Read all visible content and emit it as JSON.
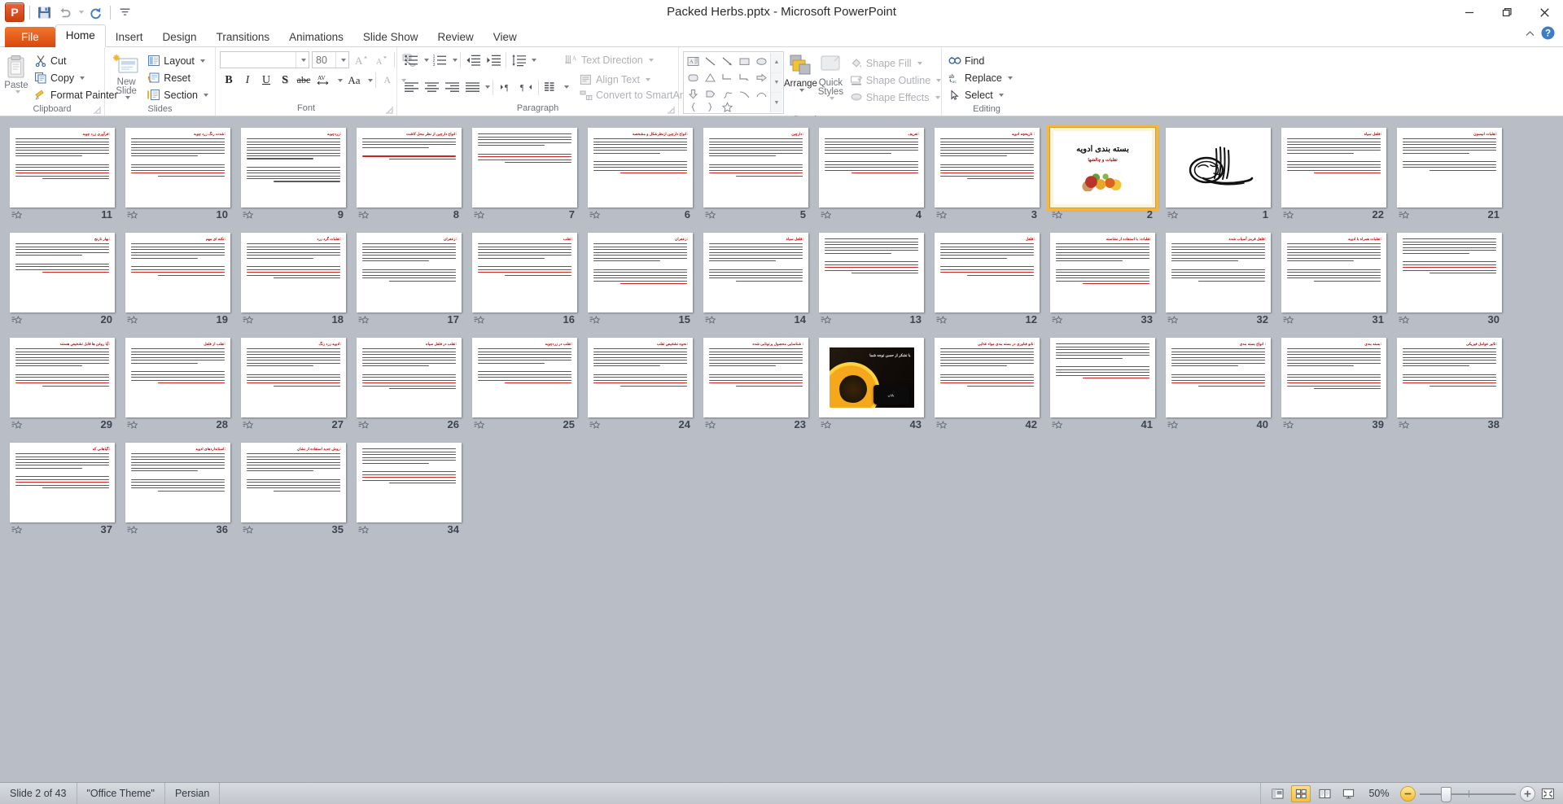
{
  "window": {
    "title": "Packed Herbs.pptx  -  Microsoft PowerPoint",
    "app_logo": "powerpoint-logo",
    "minimize": "minimize-icon",
    "restore": "restore-icon",
    "close": "close-icon",
    "collapse_ribbon": "collapse-ribbon-icon",
    "help": "help-icon"
  },
  "quick_access": [
    {
      "name": "save-icon",
      "label": "Save"
    },
    {
      "name": "undo-icon",
      "label": "Undo"
    },
    {
      "name": "redo-icon",
      "label": "Redo"
    },
    {
      "name": "customize-qat-icon",
      "label": "Customize Quick Access Toolbar"
    }
  ],
  "tabs": [
    {
      "label": "File",
      "active": false
    },
    {
      "label": "Home",
      "active": true
    },
    {
      "label": "Insert",
      "active": false
    },
    {
      "label": "Design",
      "active": false
    },
    {
      "label": "Transitions",
      "active": false
    },
    {
      "label": "Animations",
      "active": false
    },
    {
      "label": "Slide Show",
      "active": false
    },
    {
      "label": "Review",
      "active": false
    },
    {
      "label": "View",
      "active": false
    }
  ],
  "ribbon": {
    "groups": [
      "Clipboard",
      "Slides",
      "Font",
      "Paragraph",
      "Drawing",
      "Editing"
    ],
    "clipboard": {
      "paste": "Paste",
      "cut": "Cut",
      "copy": "Copy",
      "format_painter": "Format Painter",
      "label": "Clipboard"
    },
    "slides": {
      "new_slide": "New Slide",
      "layout": "Layout",
      "reset": "Reset",
      "section": "Section",
      "label": "Slides"
    },
    "font": {
      "font_name_value": "",
      "font_name_placeholder": "",
      "font_size_value": "80",
      "grow_font": "A",
      "shrink_font": "A",
      "clear_formatting": "Clear All Formatting",
      "bold": "B",
      "italic": "I",
      "underline": "U",
      "shadow": "S",
      "strikethrough": "abc",
      "char_spacing": "AV",
      "change_case": "Aa",
      "font_color": "A",
      "label": "Font"
    },
    "paragraph": {
      "bullets": "Bullets",
      "numbering": "Numbering",
      "decrease_indent": "Decrease List Level",
      "increase_indent": "Increase List Level",
      "line_spacing": "Line Spacing",
      "align_left": "Align Text Left",
      "align_center": "Center",
      "align_right": "Align Text Right",
      "justify": "Justify",
      "ltr": "Left-to-Right",
      "rtl": "Right-to-Left",
      "columns": "Columns",
      "text_direction": "Text Direction",
      "align_text": "Align Text",
      "convert_smartart": "Convert to SmartArt",
      "label": "Paragraph"
    },
    "drawing": {
      "arrange": "Arrange",
      "quick_styles": "Quick Styles",
      "shape_fill": "Shape Fill",
      "shape_outline": "Shape Outline",
      "shape_effects": "Shape Effects",
      "label": "Drawing",
      "shapes": [
        "textbox",
        "line",
        "arrow",
        "rectangle",
        "oval",
        "rounded-rectangle",
        "triangle",
        "elbow-connector",
        "elbow-arrow-connector",
        "right-arrow",
        "down-arrow",
        "pentagon-flow",
        "freeform",
        "curve",
        "arc",
        "left-brace",
        "right-brace",
        "star"
      ]
    },
    "editing": {
      "find": "Find",
      "replace": "Replace",
      "select": "Select",
      "label": "Editing"
    }
  },
  "status": {
    "slide_counter": "Slide 2 of 43",
    "theme": "\"Office Theme\"",
    "language": "Persian",
    "zoom_level": "50%",
    "views": [
      {
        "name": "normal-view-button",
        "label": "Normal",
        "active": false
      },
      {
        "name": "slide-sorter-view-button",
        "label": "Slide Sorter",
        "active": true
      },
      {
        "name": "reading-view-button",
        "label": "Reading View",
        "active": false
      },
      {
        "name": "slide-show-button",
        "label": "Slide Show",
        "active": false
      }
    ],
    "zoom_out": "Zoom Out",
    "zoom_in": "Zoom In",
    "fit_to_window": "Fit slide to current window"
  },
  "presentation": {
    "total_slides": 43,
    "selected_slide": 2,
    "slides": [
      {
        "n": 11,
        "kind": "text",
        "title": "فرآوری زرد چوبه:",
        "lines": 13
      },
      {
        "n": 10,
        "kind": "text",
        "title": "شدت رنگ زرد چوبه:",
        "lines": 12
      },
      {
        "n": 9,
        "kind": "text",
        "title": "زردچوبه:",
        "lines": 14
      },
      {
        "n": 8,
        "kind": "text",
        "title": "انواع دارچین از نظر محل کاشت:",
        "lines": 6
      },
      {
        "n": 7,
        "kind": "text",
        "title": "",
        "lines": 9
      },
      {
        "n": 6,
        "kind": "text",
        "title": "انواع دارچین ازنظرشکل و مشخصه:",
        "lines": 11
      },
      {
        "n": 5,
        "kind": "text",
        "title": "دارچین:",
        "lines": 12
      },
      {
        "n": 4,
        "kind": "text",
        "title": "تعریف:",
        "lines": 11
      },
      {
        "n": 3,
        "kind": "text",
        "title": "تاریخچه ادویه :",
        "lines": 13
      },
      {
        "n": 2,
        "kind": "title",
        "title": "بسته بندی ادویه",
        "subtitle": "تقلبات و چالشها"
      },
      {
        "n": 1,
        "kind": "bismillah",
        "title": ""
      },
      {
        "n": 22,
        "kind": "text",
        "title": "فلفل سیاه:",
        "lines": 11
      },
      {
        "n": 21,
        "kind": "text",
        "title": "تقلبات انیسون:",
        "lines": 10
      },
      {
        "n": 20,
        "kind": "text",
        "title": "بهار نارنج:",
        "lines": 9
      },
      {
        "n": 19,
        "kind": "text",
        "title": "نکته ای مهم:",
        "lines": 10
      },
      {
        "n": 18,
        "kind": "text",
        "title": "تقلبات گرد زرد:",
        "lines": 11
      },
      {
        "n": 17,
        "kind": "text",
        "title": "زعفران:",
        "lines": 12
      },
      {
        "n": 16,
        "kind": "text",
        "title": "تقلب:",
        "lines": 10
      },
      {
        "n": 15,
        "kind": "text",
        "title": "زعفران:",
        "lines": 13
      },
      {
        "n": 14,
        "kind": "text",
        "title": "فلفل سیاه:",
        "lines": 12
      },
      {
        "n": 13,
        "kind": "text",
        "title": "",
        "lines": 11
      },
      {
        "n": 12,
        "kind": "text",
        "title": "فلفل:",
        "lines": 10
      },
      {
        "n": 33,
        "kind": "text",
        "title": "تقلبات: با استفاده از نشاسته",
        "lines": 13
      },
      {
        "n": 32,
        "kind": "text",
        "title": "فلفل قرمز آسیاب شده:",
        "lines": 12
      },
      {
        "n": 31,
        "kind": "text",
        "title": "تقلبات همراه با ادویه:",
        "lines": 12
      },
      {
        "n": 30,
        "kind": "text",
        "title": "",
        "lines": 11
      },
      {
        "n": 29,
        "kind": "text",
        "title": "آیا روغن ها قابل تشخیص هستند:",
        "lines": 12
      },
      {
        "n": 28,
        "kind": "text",
        "title": "تقلب از فلفل:",
        "lines": 11
      },
      {
        "n": 27,
        "kind": "text",
        "title": "ادویه زرد رنگ:",
        "lines": 12
      },
      {
        "n": 26,
        "kind": "text",
        "title": "تقلب در فلفل سیاه:",
        "lines": 13
      },
      {
        "n": 25,
        "kind": "text",
        "title": "تقلب در زردچوبه:",
        "lines": 11
      },
      {
        "n": 24,
        "kind": "text",
        "title": "نحوه تشخیص تقلب:",
        "lines": 12
      },
      {
        "n": 23,
        "kind": "text",
        "title": "شناسایی محصول پرتوتابی شده :",
        "lines": 12
      },
      {
        "n": 43,
        "kind": "thanks",
        "title": "با تشکر از حسن توجه شما",
        "subtitle": "پایان"
      },
      {
        "n": 42,
        "kind": "text",
        "title": "نانو فناوری در بسته بندی مواد غذایی:",
        "lines": 12
      },
      {
        "n": 41,
        "kind": "text",
        "title": "",
        "lines": 11
      },
      {
        "n": 40,
        "kind": "text",
        "title": "انواع بسته بندی :",
        "lines": 12
      },
      {
        "n": 39,
        "kind": "text",
        "title": "بسته بندی:",
        "lines": 13
      },
      {
        "n": 38,
        "kind": "text",
        "title": "تاثیر عوامل فیزیکی:",
        "lines": 12
      },
      {
        "n": 37,
        "kind": "text",
        "title": "گیاهانی که:",
        "lines": 11
      },
      {
        "n": 36,
        "kind": "text",
        "title": "استانداردهای ادویه:",
        "lines": 12
      },
      {
        "n": 35,
        "kind": "text",
        "title": "روش جدید استفاده از نشان:",
        "lines": 12
      },
      {
        "n": 34,
        "kind": "text",
        "title": "",
        "lines": 11
      }
    ]
  }
}
